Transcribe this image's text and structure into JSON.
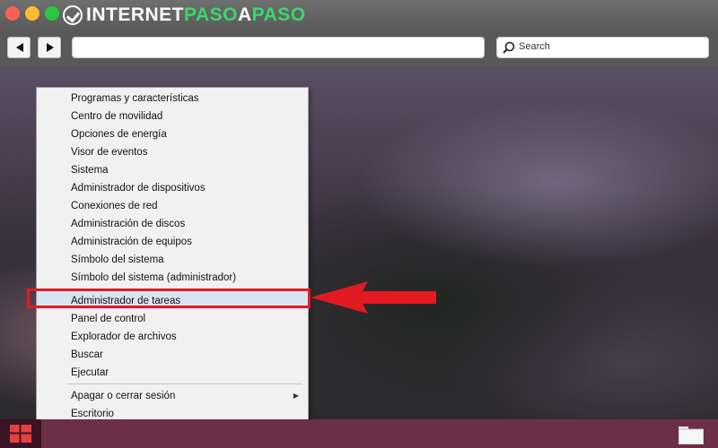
{
  "browser": {
    "logo": {
      "part1": "INTERNET",
      "part2": "PASO",
      "part3": "A",
      "part4": "PASO"
    },
    "search": {
      "placeholder": "Search"
    },
    "url": {
      "value": ""
    }
  },
  "menu": {
    "items": [
      {
        "label": "Programas y características"
      },
      {
        "label": "Centro de movilidad"
      },
      {
        "label": "Opciones de energía"
      },
      {
        "label": "Visor de eventos"
      },
      {
        "label": "Sistema"
      },
      {
        "label": "Administrador de dispositivos"
      },
      {
        "label": "Conexiones de red"
      },
      {
        "label": "Administración de discos"
      },
      {
        "label": "Administración de equipos"
      },
      {
        "label": "Símbolo del sistema"
      },
      {
        "label": "Símbolo del sistema (administrador)"
      },
      {
        "label": "Administrador de tareas",
        "selected": true
      },
      {
        "label": "Panel de control"
      },
      {
        "label": "Explorador de archivos"
      },
      {
        "label": "Buscar"
      },
      {
        "label": "Ejecutar"
      },
      {
        "label": "Apagar o cerrar sesión",
        "submenu": true
      },
      {
        "label": "Escritorio"
      }
    ]
  },
  "colors": {
    "highlight": "#e21a22",
    "logo_accent": "#39d86a",
    "taskbar": "#6b2f48"
  },
  "icons": [
    "back-arrow-icon",
    "forward-arrow-icon",
    "search-icon",
    "windows-logo-icon",
    "folder-icon",
    "submenu-chevron-icon"
  ]
}
